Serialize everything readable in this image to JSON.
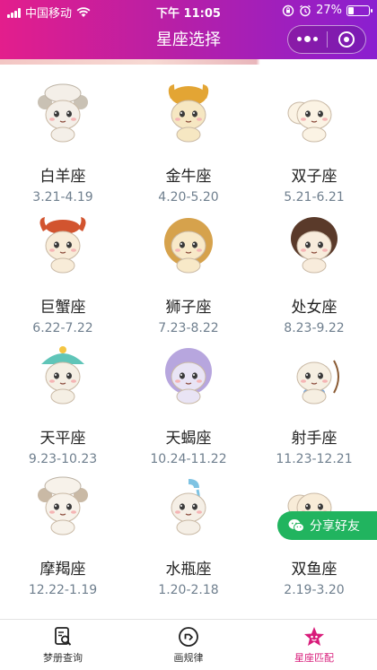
{
  "status_bar": {
    "carrier": "中国移动",
    "time": "下午 11:05",
    "battery_percent": "27%",
    "battery_level": 0.27
  },
  "nav": {
    "title": "星座选择"
  },
  "colors": {
    "header_gradient_start": "#e31e8c",
    "header_gradient_end": "#8a1fd0",
    "date_text": "#6f7f8e",
    "share_green": "#21b45f",
    "active_tab": "#d81b7a"
  },
  "zodiac": [
    {
      "name": "白羊座",
      "date": "3.21-4.19",
      "icon": "aries-cartoon-icon"
    },
    {
      "name": "金牛座",
      "date": "4.20-5.20",
      "icon": "taurus-cartoon-icon"
    },
    {
      "name": "双子座",
      "date": "5.21-6.21",
      "icon": "gemini-cartoon-icon"
    },
    {
      "name": "巨蟹座",
      "date": "6.22-7.22",
      "icon": "cancer-cartoon-icon"
    },
    {
      "name": "狮子座",
      "date": "7.23-8.22",
      "icon": "leo-cartoon-icon"
    },
    {
      "name": "处女座",
      "date": "8.23-9.22",
      "icon": "virgo-cartoon-icon"
    },
    {
      "name": "天平座",
      "date": "9.23-10.23",
      "icon": "libra-cartoon-icon"
    },
    {
      "name": "天蝎座",
      "date": "10.24-11.22",
      "icon": "scorpio-cartoon-icon"
    },
    {
      "name": "射手座",
      "date": "11.23-12.21",
      "icon": "sagittarius-cartoon-icon"
    },
    {
      "name": "摩羯座",
      "date": "12.22-1.19",
      "icon": "capricorn-cartoon-icon"
    },
    {
      "name": "水瓶座",
      "date": "1.20-2.18",
      "icon": "aquarius-cartoon-icon"
    },
    {
      "name": "双鱼座",
      "date": "2.19-3.20",
      "icon": "pisces-cartoon-icon"
    }
  ],
  "share": {
    "label": "分享好友",
    "icon": "wechat-icon"
  },
  "tabs": [
    {
      "label": "梦册查询",
      "icon": "dream-search-icon",
      "active": false
    },
    {
      "label": "画规律",
      "icon": "pattern-arrow-icon",
      "active": false
    },
    {
      "label": "星座匹配",
      "icon": "star-match-icon",
      "active": true
    }
  ]
}
